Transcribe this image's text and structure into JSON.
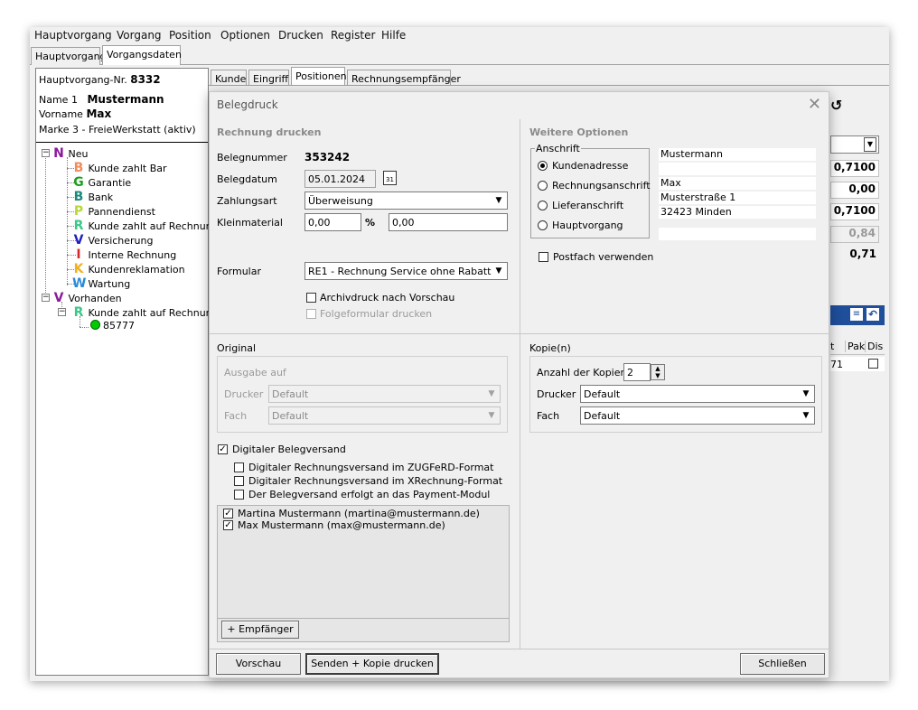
{
  "menu": [
    "Hauptvorgang",
    "Vorgang",
    "Position",
    "Optionen",
    "Drucken",
    "Register",
    "Hilfe"
  ],
  "main_tabs": [
    "Hauptvorgang",
    "Vorgangsdaten"
  ],
  "info": {
    "vorgang_label": "Hauptvorgang-Nr.",
    "vorgang_nr": "8332",
    "name1_label": "Name 1",
    "name1": "Mustermann",
    "vorname_label": "Vorname",
    "vorname": "Max",
    "marke": "Marke 3 - FreieWerkstatt (aktiv)"
  },
  "tree": {
    "neu": "Neu",
    "items": [
      {
        "letter": "B",
        "color": "#f28c5a",
        "label": "Kunde zahlt Bar"
      },
      {
        "letter": "G",
        "color": "#1e9e1e",
        "label": "Garantie"
      },
      {
        "letter": "B",
        "color": "#1a8a7a",
        "label": "Bank"
      },
      {
        "letter": "P",
        "color": "#b8d838",
        "label": "Pannendienst"
      },
      {
        "letter": "R",
        "color": "#3ac88a",
        "label": "Kunde zahlt auf Rechnung"
      },
      {
        "letter": "V",
        "color": "#1f1fbf",
        "label": "Versicherung"
      },
      {
        "letter": "I",
        "color": "#d62828",
        "label": "Interne Rechnung"
      },
      {
        "letter": "K",
        "color": "#f0b020",
        "label": "Kundenreklamation"
      },
      {
        "letter": "W",
        "color": "#2a8ad8",
        "label": "Wartung"
      }
    ],
    "vorhanden": "Vorhanden",
    "vorhanden_child": {
      "letter": "R",
      "color": "#3ac88a",
      "label": "Kunde zahlt auf Rechnung"
    },
    "beleg": "85777",
    "neu_color": "#8a1a9a",
    "vorhanden_color": "#8a1a9a"
  },
  "right_tabs": [
    "Kunde",
    "Eingriff",
    "Positionen",
    "Rechnungsempfänger"
  ],
  "bg_values": [
    "0,7100",
    "0,00",
    "0,7100",
    "0,84",
    "0,71"
  ],
  "bg_table": {
    "headers": [
      "t",
      "Pak",
      "Dis"
    ],
    "cell": "71"
  },
  "dialog": {
    "title": "Belegdruck",
    "left_title": "Rechnung drucken",
    "right_title": "Weitere Optionen",
    "belegnummer_label": "Belegnummer",
    "belegnummer": "353242",
    "belegdatum_label": "Belegdatum",
    "belegdatum": "05.01.2024",
    "zahlungsart_label": "Zahlungsart",
    "zahlungsart": "Überweisung",
    "kleinmaterial_label": "Kleinmaterial",
    "kleinmaterial_value": "0,00",
    "percent_sign": "%",
    "kleinmaterial_amount": "0,00",
    "formular_label": "Formular",
    "formular": "RE1 - Rechnung Service ohne Rabatt",
    "archivdruck": "Archivdruck nach Vorschau",
    "folgeformular": "Folgeformular drucken",
    "anschrift_title": "Anschrift",
    "anschrift_options": [
      "Kundenadresse",
      "Rechnungsanschrift",
      "Lieferanschrift",
      "Hauptvorgang"
    ],
    "address_lines": [
      "Mustermann",
      "",
      "Max",
      "Musterstraße 1",
      "32423 Minden",
      ""
    ],
    "postfach": "Postfach verwenden",
    "original_title": "Original",
    "ausgabe_auf": "Ausgabe auf",
    "drucker_label": "Drucker",
    "fach_label": "Fach",
    "drucker_value": "Default",
    "fach_value": "Default",
    "kopien_title": "Kopie(n)",
    "anzahl_label": "Anzahl der Kopien",
    "anzahl": "2",
    "kopie_drucker": "Default",
    "kopie_fach": "Default",
    "digital_belegversand": "Digitaler Belegversand",
    "digital_options": [
      "Digitaler Rechnungsversand im ZUGFeRD-Format",
      "Digitaler Rechnungsversand im XRechnung-Format",
      "Der Belegversand erfolgt an das Payment-Modul"
    ],
    "recipients": [
      "Martina Mustermann (martina@mustermann.de)",
      "Max Mustermann (max@mustermann.de)"
    ],
    "add_recipient": "+ Empfänger",
    "vorschau": "Vorschau",
    "senden": "Senden + Kopie drucken",
    "schliessen": "Schließen"
  }
}
